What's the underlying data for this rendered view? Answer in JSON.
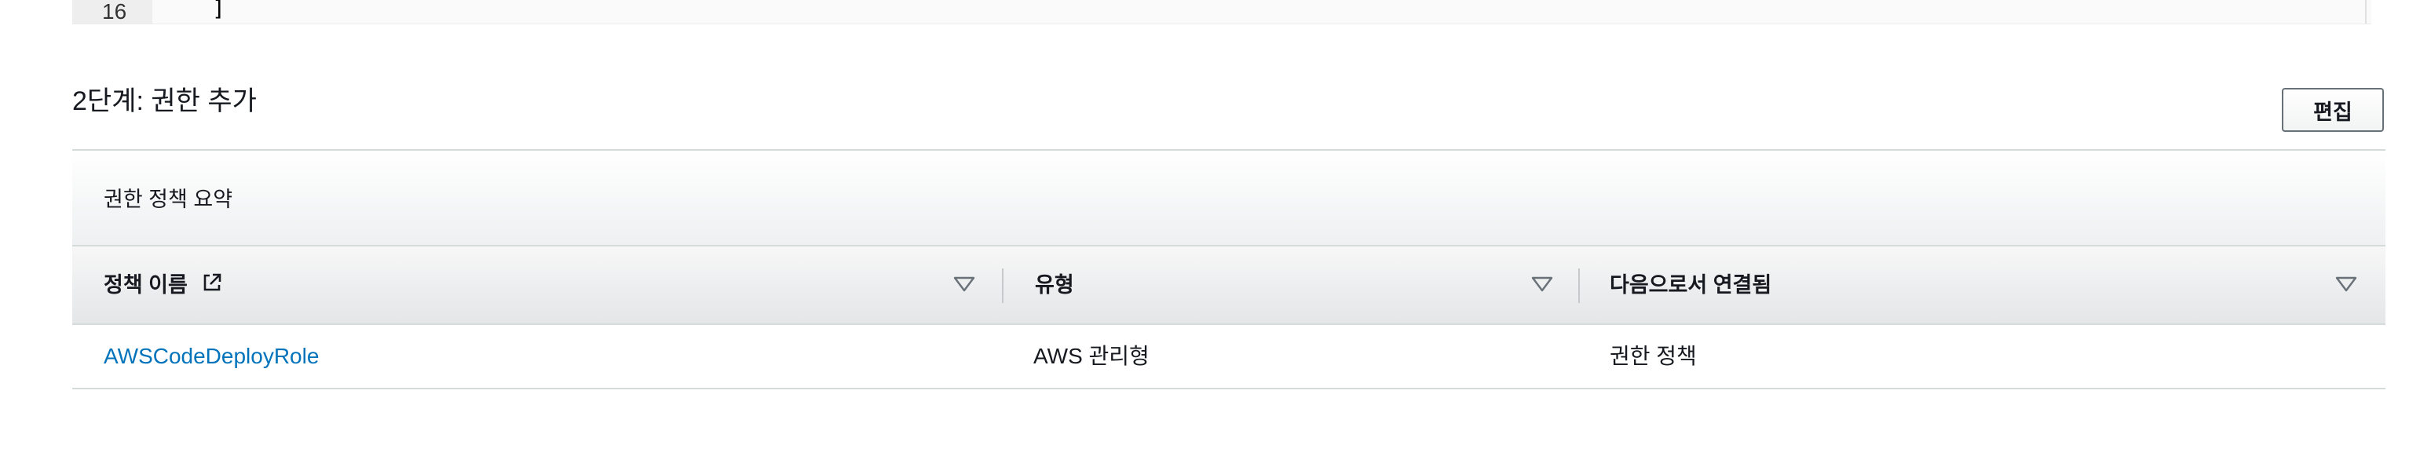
{
  "editor": {
    "line_number": "16",
    "line_text": "]"
  },
  "section": {
    "title": "2단계: 권한 추가",
    "edit_label": "편집"
  },
  "policy_table": {
    "title": "권한 정책 요약",
    "columns": [
      {
        "label": "정책 이름",
        "has_external_link_icon": true
      },
      {
        "label": "유형"
      },
      {
        "label": "다음으로서 연결됨"
      }
    ],
    "rows": [
      {
        "policy_name": "AWSCodeDeployRole",
        "type": "AWS 관리형",
        "attached_as": "권한 정책"
      }
    ]
  },
  "colors": {
    "link": "#0073bb",
    "text": "#16191f",
    "border": "#d5dbdb",
    "button_border": "#687078"
  },
  "icons": [
    "external-link-icon",
    "sort-caret-icon"
  ]
}
